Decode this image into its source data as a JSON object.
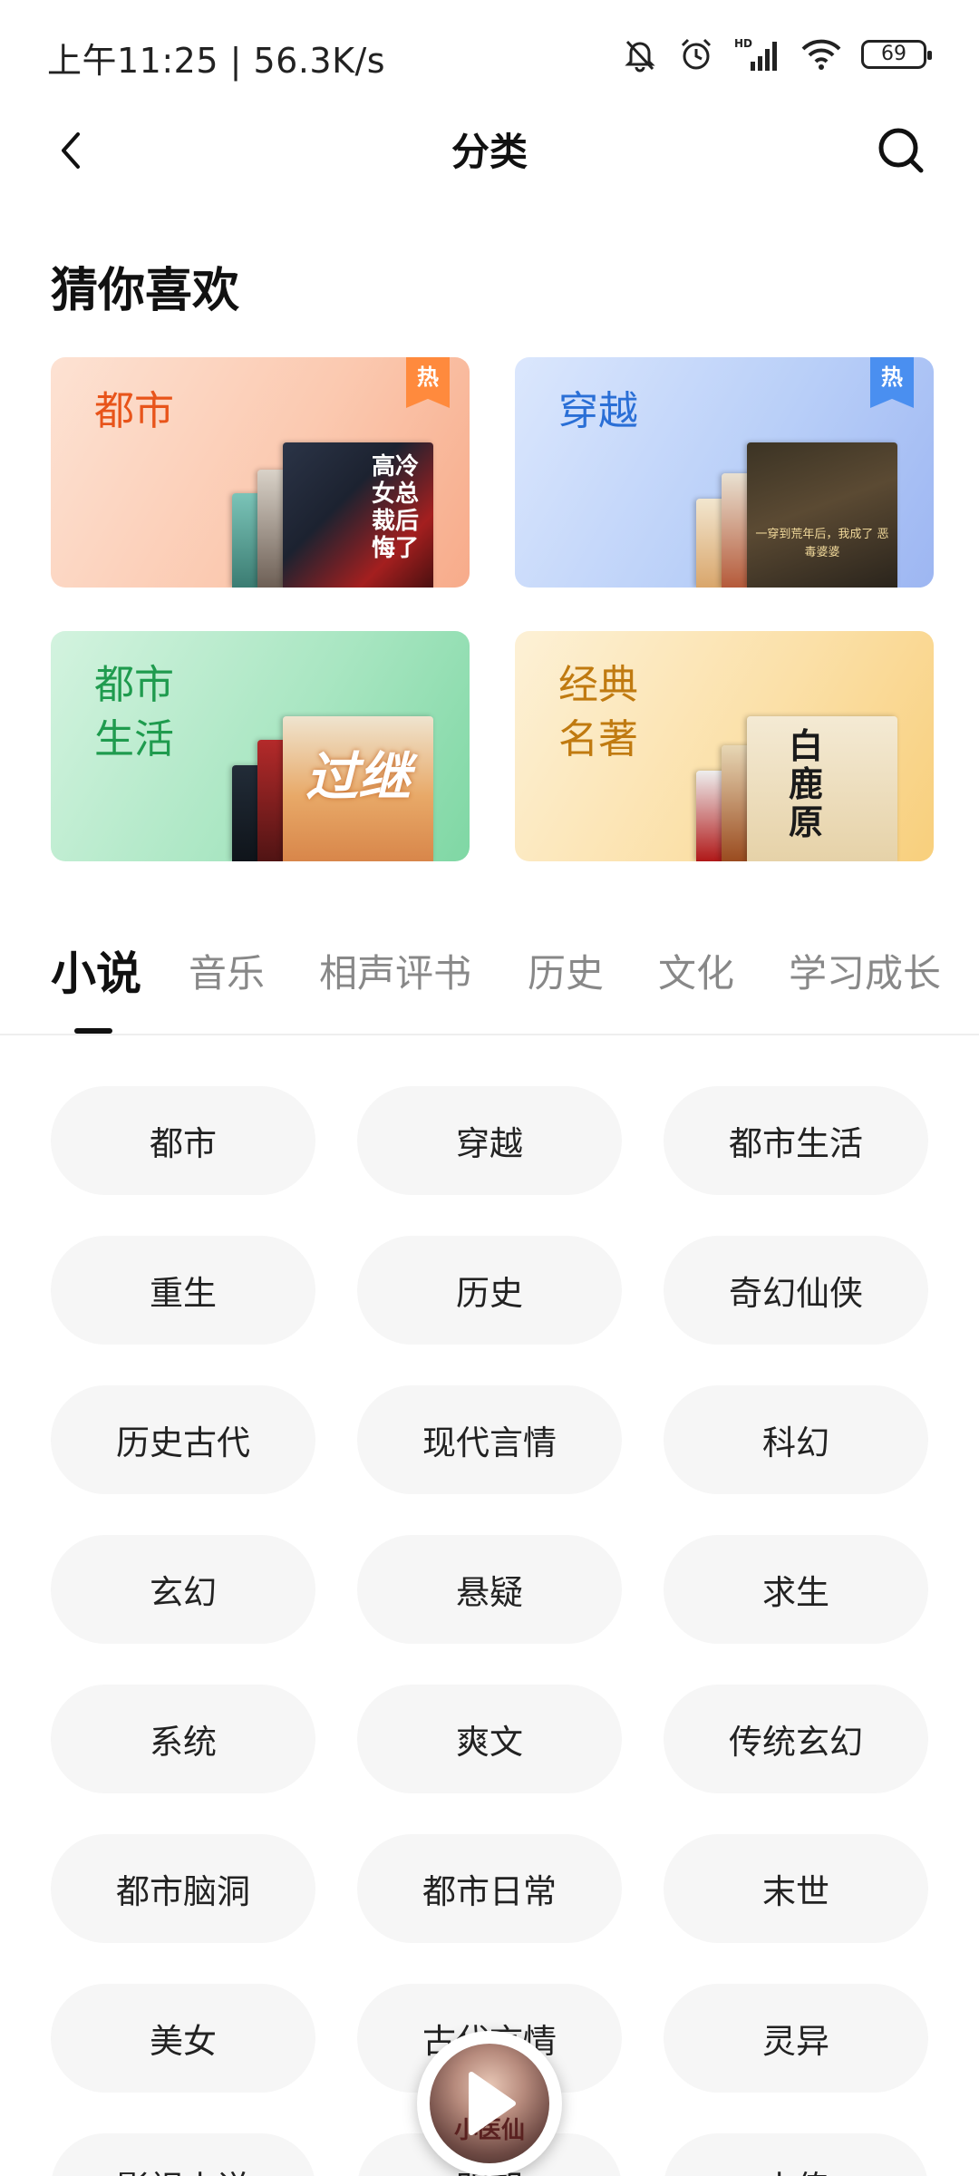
{
  "status_bar": {
    "time": "上午11:25 | 56.3K/s",
    "battery": "69",
    "network_label": "HD"
  },
  "nav": {
    "title": "分类"
  },
  "guess": {
    "title": "猜你喜欢",
    "cards": [
      {
        "label": "都市",
        "hot": "热",
        "label_color": "#e8541a",
        "badge_color": "#ff8a3d"
      },
      {
        "label": "穿越",
        "hot": "热",
        "label_color": "#2a6fd6",
        "badge_color": "#4a8ff0"
      },
      {
        "label": "都市\n生活",
        "label_color": "#1f9b4e"
      },
      {
        "label": "经典\n名著",
        "label_color": "#c07a10"
      }
    ],
    "book_cover_texts": [
      "高冷女总裁后悔了",
      "一穿到荒年后，我成了 恶毒婆婆",
      "过继",
      "白鹿原"
    ]
  },
  "tabs": [
    {
      "label": "小说",
      "active": true
    },
    {
      "label": "音乐"
    },
    {
      "label": "相声评书"
    },
    {
      "label": "历史"
    },
    {
      "label": "文化"
    },
    {
      "label": "学习成长"
    }
  ],
  "genres": [
    "都市",
    "穿越",
    "都市生活",
    "重生",
    "历史",
    "奇幻仙侠",
    "历史古代",
    "现代言情",
    "科幻",
    "玄幻",
    "悬疑",
    "求生",
    "系统",
    "爽文",
    "传统玄幻",
    "都市脑洞",
    "都市日常",
    "末世",
    "美女",
    "古代言情",
    "灵异",
    "影视小说",
    "明朝",
    "小传"
  ],
  "player": {
    "cover_text": "小医仙"
  }
}
